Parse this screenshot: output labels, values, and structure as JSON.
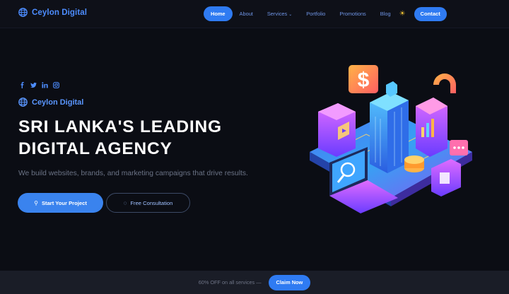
{
  "nav": {
    "brand": "Ceylon Digital",
    "links": [
      {
        "label": "Home",
        "active": true
      },
      {
        "label": "About"
      },
      {
        "label": "Services",
        "dropdown": true
      },
      {
        "label": "Portfolio"
      },
      {
        "label": "Promotions"
      },
      {
        "label": "Blog"
      }
    ],
    "theme_icon": "sun-icon",
    "contact": "Contact"
  },
  "hero": {
    "socials": [
      "facebook-icon",
      "twitter-icon",
      "linkedin-icon",
      "instagram-icon"
    ],
    "brand": "Ceylon Digital",
    "headline_line1": "SRI LANKA'S LEADING",
    "headline_line2": "DIGITAL AGENCY",
    "subtitle": "We build websites, brands, and marketing campaigns that drive results.",
    "primary_button": "Start Your Project",
    "secondary_button": "Free Consultation"
  },
  "promo": {
    "text": "60% OFF on all services —",
    "button": "Claim Now"
  },
  "colors": {
    "accent": "#2f7bf2",
    "background": "#0b0d14",
    "brand_text": "#4d8dff"
  }
}
